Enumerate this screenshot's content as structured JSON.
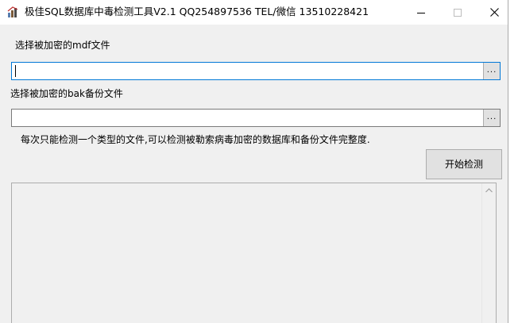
{
  "window": {
    "title": "极佳SQL数据库中毒检测工具V2.1 QQ254897536 TEL/微信 13510228421",
    "icon": "app-icon"
  },
  "window_controls": {
    "minimize_icon": "minimize-icon",
    "maximize_icon": "maximize-icon",
    "close_icon": "close-icon"
  },
  "mdf": {
    "label": "选择被加密的mdf文件",
    "value": "",
    "browse_label": "..."
  },
  "bak": {
    "label": "选择被加密的bak备份文件",
    "value": "",
    "browse_label": "..."
  },
  "hint": "每次只能检测一个类型的文件,可以检测被勒索病毒加密的数据库和备份文件完整度.",
  "start_button": "开始检测",
  "log": {
    "content": "",
    "scroll_up_icon": "scroll-up-arrow-icon"
  }
}
